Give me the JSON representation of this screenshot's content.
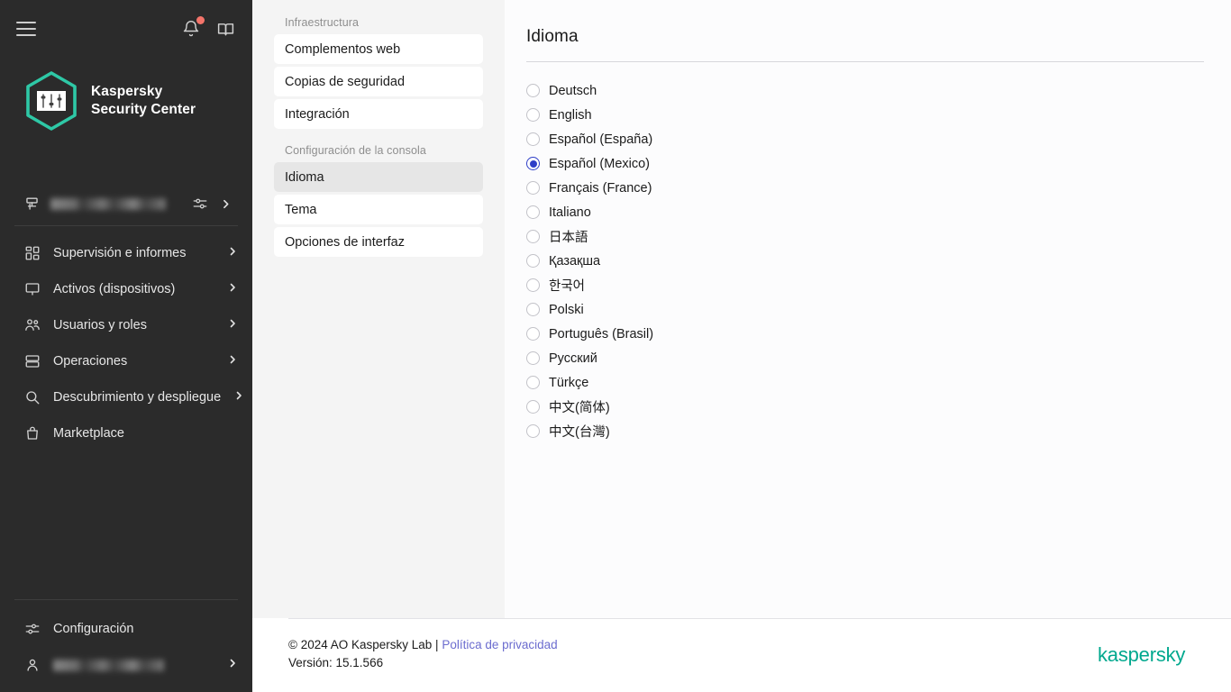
{
  "sidebar": {
    "menu_icon": "hamburger-menu-icon",
    "top_icons": [
      {
        "name": "notifications-bell-icon",
        "has_badge": true
      },
      {
        "name": "help-book-icon",
        "has_badge": false
      }
    ],
    "brand": {
      "line1": "Kaspersky",
      "line2": "Security Center",
      "logo_icon": "kaspersky-hexagon-logo",
      "accent_color": "#2ec8a6"
    },
    "server_row": {
      "icon": "server-icon",
      "name_redacted": true,
      "settings_icon": "sliders-icon",
      "chevron_icon": "chevron-right-icon"
    },
    "items": [
      {
        "label": "Supervisión e informes",
        "icon": "dashboard-grid-icon",
        "has_chevron": true
      },
      {
        "label": "Activos (dispositivos)",
        "icon": "monitor-icon",
        "has_chevron": true
      },
      {
        "label": "Usuarios y roles",
        "icon": "users-icon",
        "has_chevron": true
      },
      {
        "label": "Operaciones",
        "icon": "stacked-layers-icon",
        "has_chevron": true
      },
      {
        "label": "Descubrimiento y despliegue",
        "icon": "search-icon",
        "has_chevron": true
      },
      {
        "label": "Marketplace",
        "icon": "shopping-bag-icon",
        "has_chevron": false
      }
    ],
    "bottom_items": [
      {
        "label": "Configuración",
        "icon": "sliders-icon",
        "has_chevron": false,
        "redacted": false
      },
      {
        "label": "",
        "icon": "user-icon",
        "has_chevron": true,
        "redacted": true
      }
    ]
  },
  "settings_panel": {
    "groups": [
      {
        "title": "Infraestructura",
        "items": [
          {
            "label": "Complementos web",
            "selected": false
          },
          {
            "label": "Copias de seguridad",
            "selected": false
          },
          {
            "label": "Integración",
            "selected": false
          }
        ]
      },
      {
        "title": "Configuración de la consola",
        "items": [
          {
            "label": "Idioma",
            "selected": true
          },
          {
            "label": "Tema",
            "selected": false
          },
          {
            "label": "Opciones de interfaz",
            "selected": false
          }
        ]
      }
    ]
  },
  "main": {
    "title": "Idioma",
    "selected_language": "Español (Mexico)",
    "languages": [
      {
        "label": "Deutsch",
        "selected": false
      },
      {
        "label": "English",
        "selected": false
      },
      {
        "label": "Español (España)",
        "selected": false
      },
      {
        "label": "Español (Mexico)",
        "selected": true
      },
      {
        "label": "Français (France)",
        "selected": false
      },
      {
        "label": "Italiano",
        "selected": false
      },
      {
        "label": "日本語",
        "selected": false
      },
      {
        "label": "Қазақша",
        "selected": false
      },
      {
        "label": "한국어",
        "selected": false
      },
      {
        "label": "Polski",
        "selected": false
      },
      {
        "label": "Português (Brasil)",
        "selected": false
      },
      {
        "label": "Русский",
        "selected": false
      },
      {
        "label": "Türkçe",
        "selected": false
      },
      {
        "label": "中文(简体)",
        "selected": false
      },
      {
        "label": "中文(台灣)",
        "selected": false
      }
    ]
  },
  "footer": {
    "copyright": "© 2024 AO Kaspersky Lab | ",
    "privacy_link": "Política de privacidad",
    "version": "Versión: 15.1.566",
    "logo_text": "kaspersky",
    "logo_color": "#00a88e"
  }
}
